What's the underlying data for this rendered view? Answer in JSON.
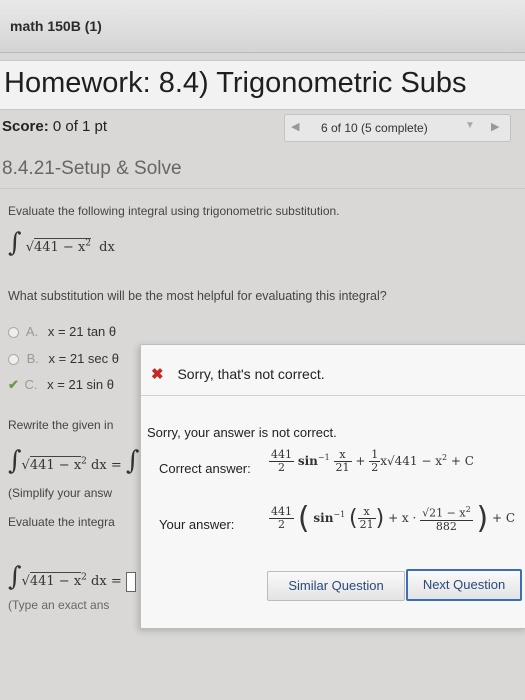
{
  "window": {
    "tab_title": "math 150B (1)"
  },
  "header": {
    "title": "Homework: 8.4) Trigonometric Subs"
  },
  "score": {
    "label": "Score:",
    "value": "0 of 1 pt"
  },
  "pager": {
    "prev": "◀",
    "text": "6 of 10 (5 complete)",
    "dropdown": "▼",
    "next": "▶"
  },
  "section": {
    "title": "8.4.21-Setup & Solve"
  },
  "question": {
    "instruction": "Evaluate the following integral using trigonometric substitution.",
    "integral": {
      "radicand": "441 − x",
      "exp": "2",
      "dx": "dx"
    },
    "prompt": "What substitution will be the most helpful for evaluating this integral?"
  },
  "options": [
    {
      "letter": "A.",
      "text": "x = 21 tan θ"
    },
    {
      "letter": "B.",
      "text": "x = 21 sec θ"
    },
    {
      "letter": "C.",
      "text": "x = 21 sin θ"
    }
  ],
  "rewrite": {
    "label": "Rewrite the given in",
    "simplify_hint": "(Simplify your answ",
    "evaluate_label": "Evaluate the integra",
    "type_hint": "(Type an exact ans"
  },
  "popup": {
    "header": "Sorry, that's not correct.",
    "message": "Sorry, your answer is not correct.",
    "correct_label": "Correct answer:",
    "your_label": "Your answer:",
    "correct": {
      "coef_num": "441",
      "coef_den": "2",
      "fn": "sin",
      "inv": "−1",
      "arg_num": "x",
      "arg_den": "21",
      "plus": "+",
      "half_num": "1",
      "half_den": "2",
      "rest": "x√441 − x",
      "rest_exp": "2",
      "c": "+ C"
    },
    "yours": {
      "coef_num": "441",
      "coef_den": "2",
      "fn": "sin",
      "inv": "−1",
      "arg_num": "x",
      "arg_den": "21",
      "mid": "+ x ·",
      "frac_num": "√21 − x",
      "frac_exp": "2",
      "frac_den": "882",
      "c": "+ C"
    },
    "similar_button": "Similar Question",
    "next_button": "Next Question"
  },
  "colors": {
    "error": "#c62828",
    "check": "#6a9a4a",
    "button_border": "#3a6fb3"
  }
}
